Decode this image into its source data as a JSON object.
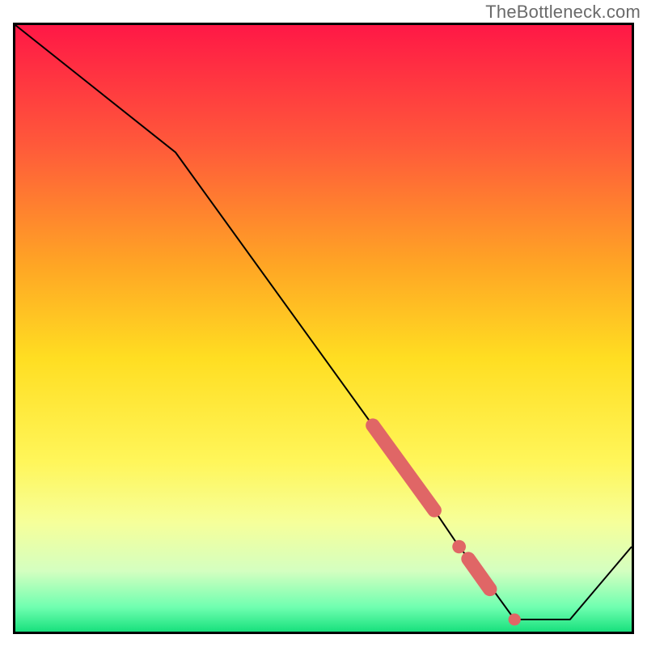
{
  "watermark": "TheBottleneck.com",
  "colors": {
    "border": "#000000",
    "line_stroke": "#000000",
    "marker_fill": "#e06666",
    "gradient_stops": [
      {
        "offset": 0.0,
        "color": "#ff1846"
      },
      {
        "offset": 0.2,
        "color": "#ff5a3a"
      },
      {
        "offset": 0.4,
        "color": "#ffa724"
      },
      {
        "offset": 0.55,
        "color": "#ffde22"
      },
      {
        "offset": 0.72,
        "color": "#fff65a"
      },
      {
        "offset": 0.82,
        "color": "#f6ff9a"
      },
      {
        "offset": 0.9,
        "color": "#d4ffc0"
      },
      {
        "offset": 0.96,
        "color": "#6fffb0"
      },
      {
        "offset": 1.0,
        "color": "#18e07d"
      }
    ]
  },
  "chart_data": {
    "type": "line",
    "title": "",
    "xlabel": "",
    "ylabel": "",
    "xlim": [
      0,
      100
    ],
    "ylim": [
      0,
      100
    ],
    "series": [
      {
        "name": "curve",
        "x": [
          0,
          26,
          58,
          65,
          68,
          72,
          76,
          81,
          90,
          100
        ],
        "y": [
          100,
          79,
          34,
          24,
          20,
          14,
          9,
          2,
          2,
          14
        ]
      }
    ],
    "markers": [
      {
        "type": "thick_segment",
        "x0": 58,
        "y0": 34,
        "x1": 68,
        "y1": 20
      },
      {
        "type": "dot",
        "x": 72,
        "y": 14,
        "r": 1.1
      },
      {
        "type": "thick_segment",
        "x0": 73.5,
        "y0": 12,
        "x1": 77,
        "y1": 7
      },
      {
        "type": "dot",
        "x": 81,
        "y": 2,
        "r": 1.0
      }
    ]
  }
}
